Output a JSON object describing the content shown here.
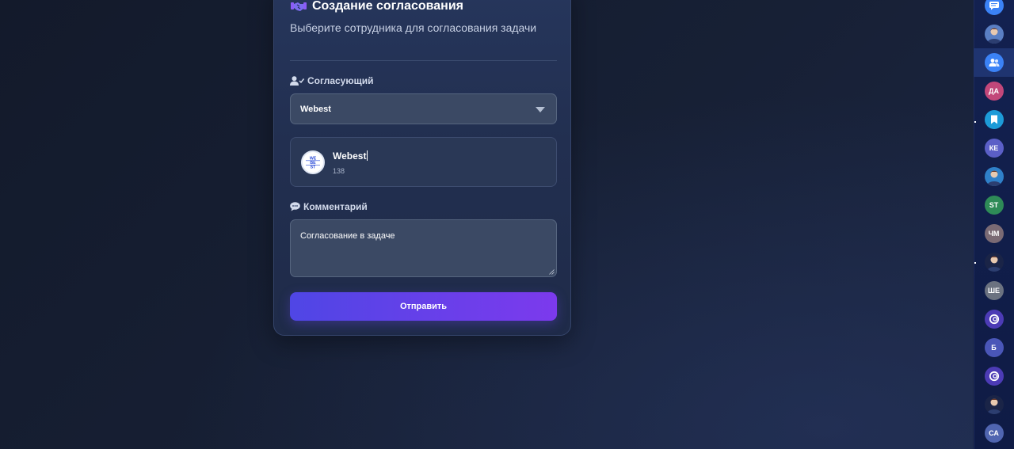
{
  "form": {
    "title": "Создание согласования",
    "subtitle": "Выберите сотрудника для согласования задачи",
    "approver_label": "Согласующий",
    "approver_select_value": "Webest",
    "selected_user": {
      "name": "Webest",
      "id": "138",
      "logo_text_lines": [
        "WE",
        "BE",
        "ST"
      ]
    },
    "comment_label": "Комментарий",
    "comment_value": "Согласование в задаче",
    "submit_label": "Отправить"
  },
  "sidebar": {
    "avatars": [
      {
        "kind": "icon",
        "icon": "chat-icon",
        "color": "#3b82f6",
        "initials": ""
      },
      {
        "kind": "photo",
        "icon": "person-photo",
        "color": "#5a7fc4",
        "initials": ""
      },
      {
        "kind": "icon",
        "icon": "group-icon",
        "color": "#3b82f6",
        "initials": "",
        "active": true
      },
      {
        "kind": "initials",
        "icon": "",
        "color": "#c2477a",
        "initials": "ДА"
      },
      {
        "kind": "icon",
        "icon": "bookmark-icon",
        "color": "#1d9bd8",
        "initials": ""
      },
      {
        "kind": "initials",
        "icon": "",
        "color": "#5b5fc7",
        "initials": "КЕ"
      },
      {
        "kind": "photo",
        "icon": "person-photo",
        "color": "#2f80c9",
        "initials": ""
      },
      {
        "kind": "initials",
        "icon": "",
        "color": "#2e8b57",
        "initials": "ST"
      },
      {
        "kind": "initials",
        "icon": "",
        "color": "#7a6a74",
        "initials": "ЧМ"
      },
      {
        "kind": "photo",
        "icon": "person-photo",
        "color": "#1a2447",
        "initials": ""
      },
      {
        "kind": "initials",
        "icon": "",
        "color": "#6b7280",
        "initials": "ШЕ"
      },
      {
        "kind": "icon",
        "icon": "swirl-logo-icon",
        "color": "#4c3bb5",
        "initials": ""
      },
      {
        "kind": "initials",
        "icon": "",
        "color": "#4a56b8",
        "initials": "Б"
      },
      {
        "kind": "icon",
        "icon": "swirl-logo-icon",
        "color": "#4c3bb5",
        "initials": ""
      },
      {
        "kind": "photo",
        "icon": "person-photo",
        "color": "#1a2447",
        "initials": ""
      },
      {
        "kind": "initials",
        "icon": "",
        "color": "#5065b0",
        "initials": "СА"
      }
    ]
  },
  "colors": {
    "accent_start": "#4f46e5",
    "accent_end": "#7c3aed",
    "card_bg": "#26365c",
    "page_bg": "#172035"
  }
}
